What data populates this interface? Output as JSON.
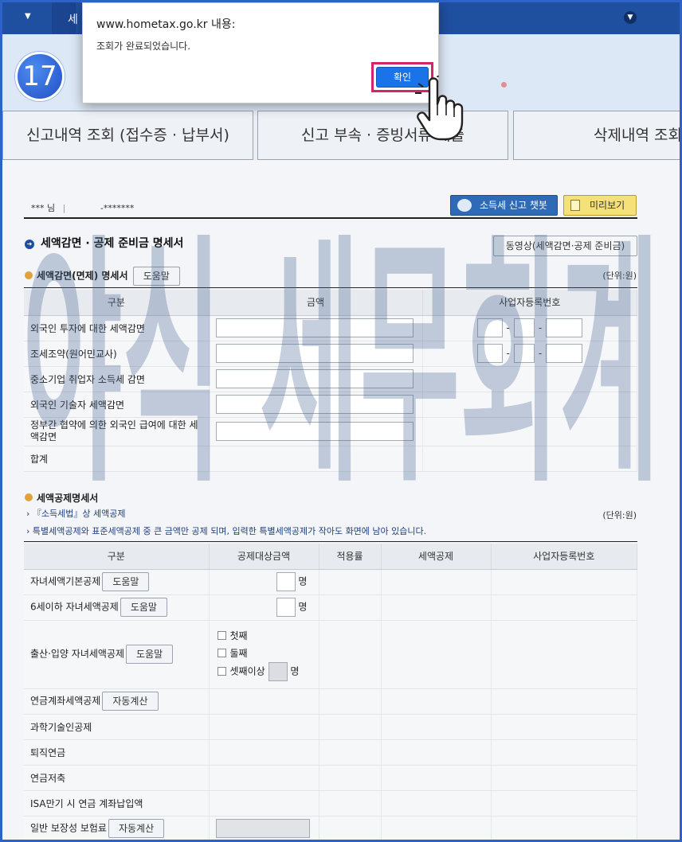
{
  "topbar": {
    "crumb_text": "세",
    "dropdown_icon": "chevron-down-icon"
  },
  "step": {
    "number": "17"
  },
  "tabs": [
    {
      "label": "신고내역 조회 (접수증 · 납부서)"
    },
    {
      "label": "신고 부속 · 증빙서류 제출"
    },
    {
      "label": "삭제내역 조회"
    }
  ],
  "user": {
    "name": "*** 님",
    "sep": "|",
    "masked_id": "-*******"
  },
  "buttons": {
    "chatbot": "소득세 신고 챗봇",
    "preview": "미리보기",
    "video": "동영상(세액감면·공제 준비금)"
  },
  "section_main": {
    "title": "세액감면 · 공제 준비금 명세서"
  },
  "section_reduction": {
    "title": "세액감면(면제) 명세서",
    "help": "도움말",
    "unit": "(단위:원)",
    "headers": [
      "구분",
      "금액",
      "사업자등록번호"
    ],
    "rows": [
      {
        "label": "외국인 투자에 대한 세액감면"
      },
      {
        "label": "조세조약(원어민교사)"
      },
      {
        "label": "중소기업 취업자 소득세 감면"
      },
      {
        "label": "외국인 기술자 세액감면"
      },
      {
        "label": "정부간 협약에 의한 외국인 급여에 대한 세액감면"
      },
      {
        "label": "합계"
      }
    ],
    "dash": "-"
  },
  "section_credit": {
    "title": "세액공제명세서",
    "link": "『소득세법』상 세액공제",
    "notice": "특별세액공제와 표준세액공제 중 큰 금액만 공제 되며, 입력한 특별세액공제가 작아도 화면에 남아 있습니다.",
    "unit": "(단위:원)",
    "headers": [
      "구분",
      "공제대상금액",
      "적용률",
      "세액공제",
      "사업자등록번호"
    ],
    "unit_person": "명",
    "help": "도움말",
    "auto": "자동계산",
    "child_basic": "자녀세액기본공제",
    "child_under6": "6세이하 자녀세액공제",
    "birth": "출산·입양 자녀세액공제",
    "birth_options": [
      "첫째",
      "둘째",
      "셋째이상"
    ],
    "pension": "연금계좌세액공제",
    "science": "과학기술인공제",
    "retire": "퇴직연금",
    "saving": "연금저축",
    "isa": "ISA만기 시 연금 계좌납입액",
    "insurance": "일반 보장성 보험료"
  },
  "watermark": {
    "text": "야식 세무회계"
  },
  "dialog": {
    "host": "www.hometax.go.kr 내용:",
    "message": "조회가 완료되었습니다.",
    "ok": "확인"
  },
  "colors": {
    "nav": "#1f4f9f",
    "accent": "#1a73e8",
    "highlight": "#d6226a",
    "watermark": "#3e5f8f"
  }
}
